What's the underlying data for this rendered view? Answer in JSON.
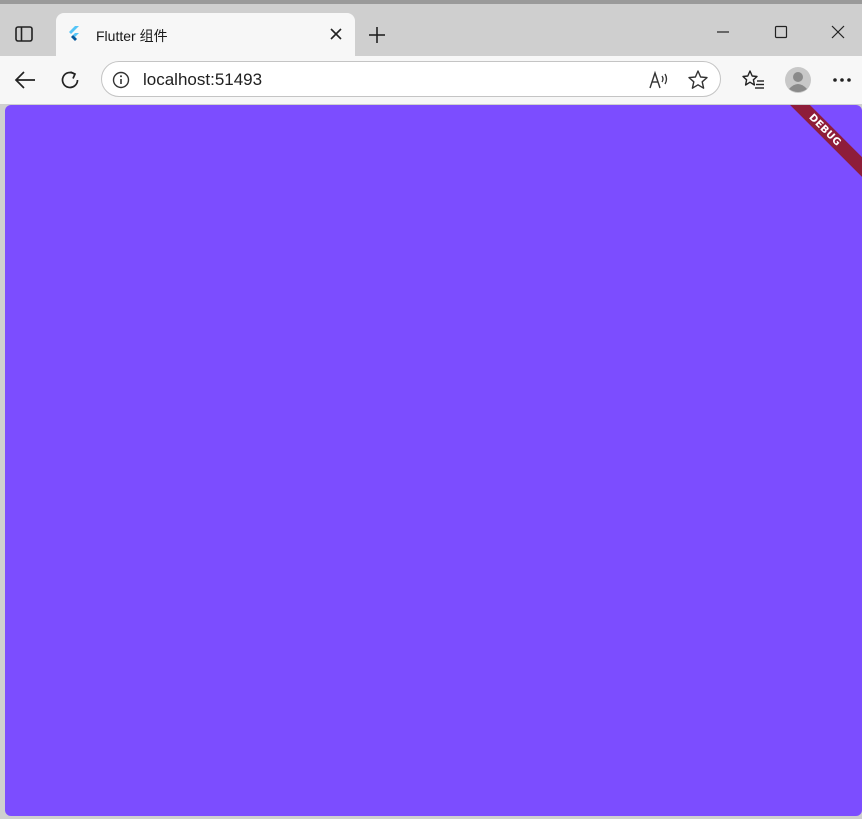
{
  "tab": {
    "title": "Flutter 组件",
    "favicon": "flutter-logo-icon"
  },
  "address_bar": {
    "url": "localhost:51493"
  },
  "page": {
    "background_color": "#7c4dff",
    "debug_banner": "DEBUG",
    "debug_banner_color": "#8e1d3a"
  },
  "icons": {
    "tab_actions": "tab-actions-icon",
    "close_tab": "close-icon",
    "new_tab": "plus-icon",
    "minimize": "minimize-icon",
    "maximize": "maximize-icon",
    "close_window": "close-icon",
    "back": "back-arrow-icon",
    "refresh": "refresh-icon",
    "site_info": "info-icon",
    "read_aloud": "read-aloud-icon",
    "favorite": "star-icon",
    "favorites": "favorites-icon",
    "profile": "profile-icon",
    "more": "more-icon"
  }
}
